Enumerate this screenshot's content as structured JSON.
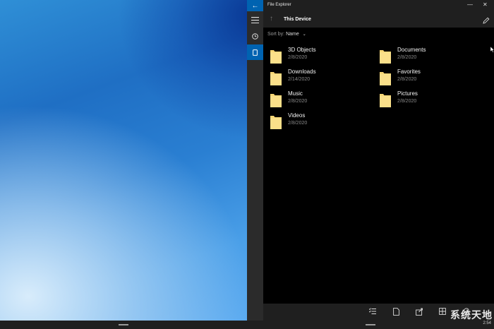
{
  "app": {
    "title": "File Explorer",
    "location": "This Device",
    "sort_label": "Sort by:",
    "sort_value": "Name"
  },
  "folders": [
    {
      "name": "3D Objects",
      "date": "2/8/2020"
    },
    {
      "name": "Documents",
      "date": "2/8/2020"
    },
    {
      "name": "Downloads",
      "date": "2/14/2020"
    },
    {
      "name": "Favorites",
      "date": "2/8/2020"
    },
    {
      "name": "Music",
      "date": "2/8/2020"
    },
    {
      "name": "Pictures",
      "date": "2/8/2020"
    },
    {
      "name": "Videos",
      "date": "2/8/2020"
    }
  ],
  "taskbar": {
    "clock": "2:54"
  },
  "watermark": {
    "text": "系统天地"
  },
  "colors": {
    "accent": "#0063b1",
    "folder": "#f8d775"
  }
}
